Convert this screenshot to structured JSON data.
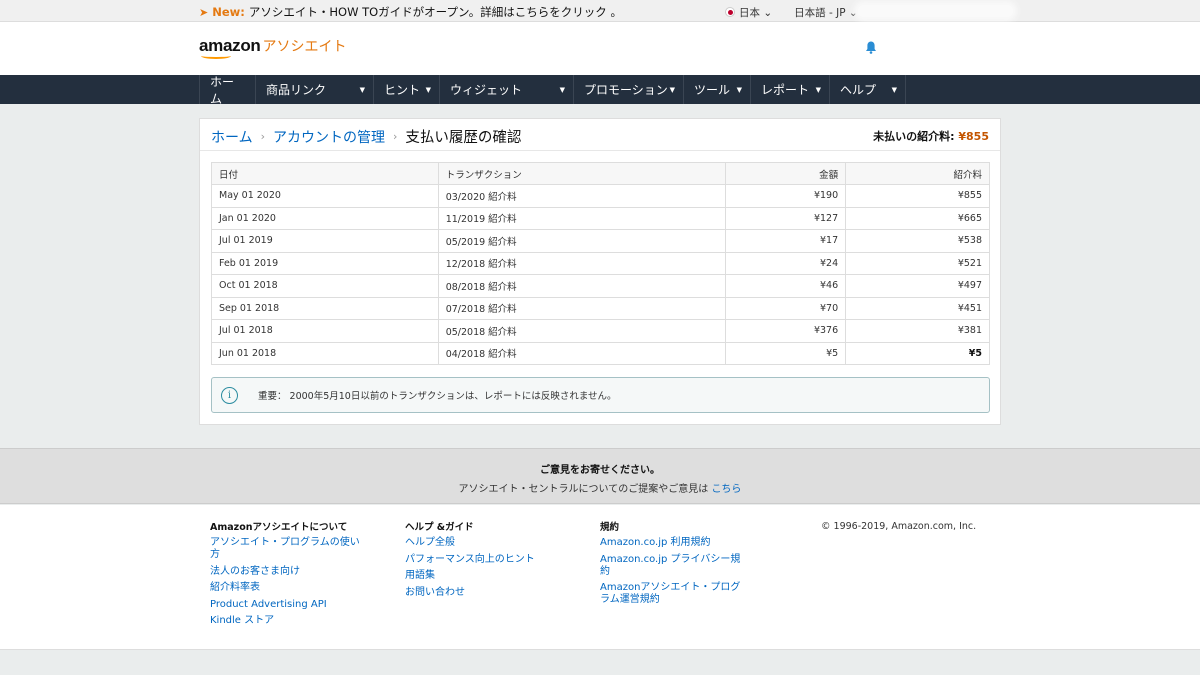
{
  "topbar": {
    "new_label": "New:",
    "announcement": "アソシエイト・HOW TOガイドがオープン。詳細はこちらをクリック 。",
    "region": "日本",
    "language": "日本語 - JP"
  },
  "header": {
    "logo_main": "amazon",
    "logo_sub": "アソシエイト"
  },
  "nav": {
    "items": [
      {
        "label": "ホーム",
        "dropdown": false
      },
      {
        "label": "商品リンク",
        "dropdown": true
      },
      {
        "label": "ヒント",
        "dropdown": true
      },
      {
        "label": "ウィジェット",
        "dropdown": true
      },
      {
        "label": "プロモーション",
        "dropdown": true
      },
      {
        "label": "ツール",
        "dropdown": true
      },
      {
        "label": "レポート",
        "dropdown": true
      },
      {
        "label": "ヘルプ",
        "dropdown": true
      }
    ]
  },
  "breadcrumb": {
    "home": "ホーム",
    "account": "アカウントの管理",
    "current": "支払い履歴の確認"
  },
  "unpaid": {
    "label": "未払いの紹介料:",
    "amount": "¥855"
  },
  "table": {
    "headers": [
      "日付",
      "トランザクション",
      "金額",
      "紹介料"
    ],
    "rows": [
      {
        "date": "May 01 2020",
        "tx": "03/2020 紹介料",
        "amount": "¥190",
        "fee": "¥855"
      },
      {
        "date": "Jan 01 2020",
        "tx": "11/2019 紹介料",
        "amount": "¥127",
        "fee": "¥665"
      },
      {
        "date": "Jul 01 2019",
        "tx": "05/2019 紹介料",
        "amount": "¥17",
        "fee": "¥538"
      },
      {
        "date": "Feb 01 2019",
        "tx": "12/2018 紹介料",
        "amount": "¥24",
        "fee": "¥521"
      },
      {
        "date": "Oct 01 2018",
        "tx": "08/2018 紹介料",
        "amount": "¥46",
        "fee": "¥497"
      },
      {
        "date": "Sep 01 2018",
        "tx": "07/2018 紹介料",
        "amount": "¥70",
        "fee": "¥451"
      },
      {
        "date": "Jul 01 2018",
        "tx": "05/2018 紹介料",
        "amount": "¥376",
        "fee": "¥381"
      },
      {
        "date": "Jun 01 2018",
        "tx": "04/2018 紹介料",
        "amount": "¥5",
        "fee": "¥5"
      }
    ]
  },
  "notice": {
    "icon": "i",
    "text": "重要： 2000年5月10日以前のトランザクションは、レポートには反映されません。"
  },
  "feedback": {
    "title": "ご意見をお寄せください。",
    "text": "アソシエイト・セントラルについてのご提案やご意見は",
    "link": "こちら"
  },
  "footer": {
    "columns": [
      {
        "title": "Amazonアソシエイトについて",
        "links": [
          "アソシエイト・プログラムの使い方",
          "法人のお客さま向け",
          "紹介料率表",
          "Product Advertising API",
          "Kindle ストア"
        ]
      },
      {
        "title": "ヘルプ &ガイド",
        "links": [
          "ヘルプ全般",
          "パフォーマンス向上のヒント",
          "用語集",
          "お問い合わせ"
        ]
      },
      {
        "title": "規約",
        "links": [
          "Amazon.co.jp 利用規約",
          "Amazon.co.jp プライバシー規約",
          "Amazonアソシエイト・プログラム運営規約"
        ]
      }
    ],
    "copyright": "© 1996-2019, Amazon.com, Inc."
  },
  "colors": {
    "accent": "#e47911",
    "nav_bg": "#232f3e",
    "link": "#0066c0"
  }
}
